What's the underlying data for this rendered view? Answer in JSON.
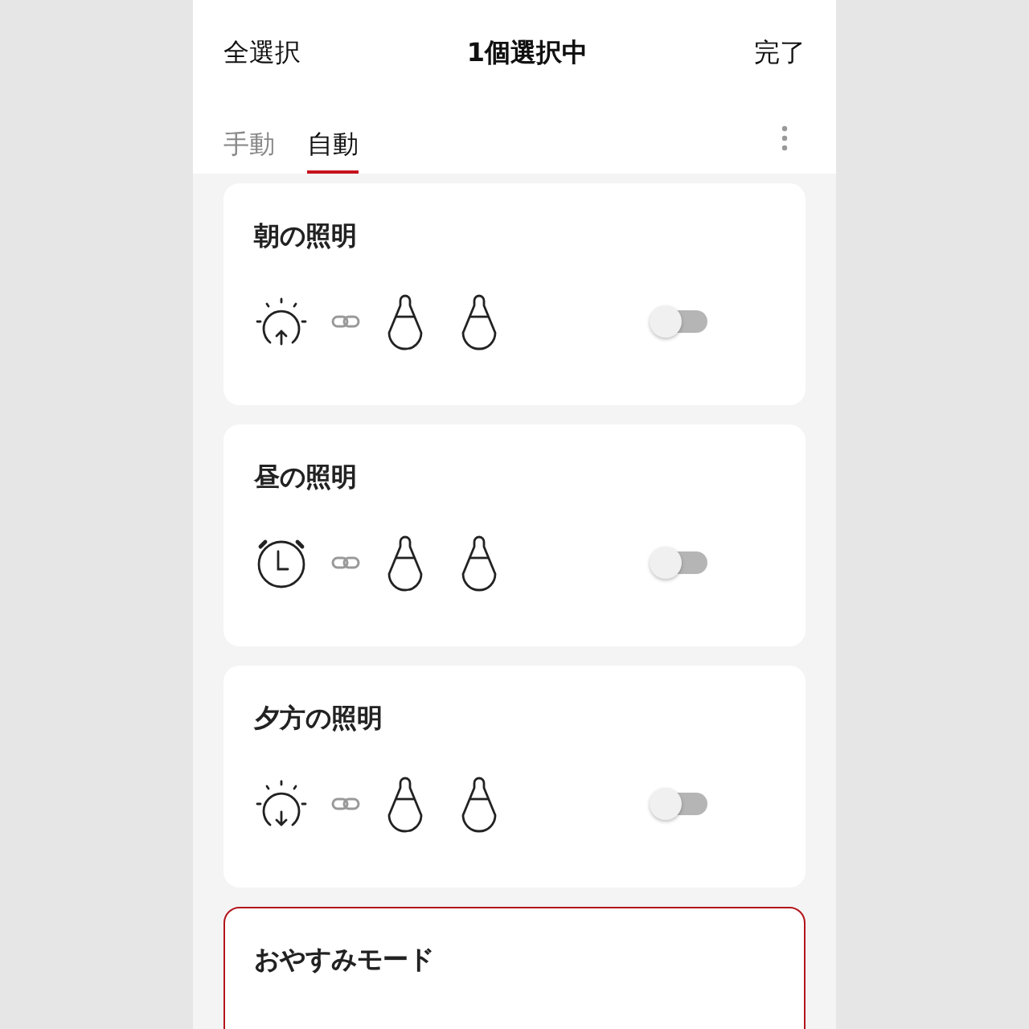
{
  "header": {
    "left_action": "全選択",
    "title": "1個選択中",
    "right_action": "完了"
  },
  "tabs": [
    {
      "label": "手動",
      "selected": false
    },
    {
      "label": "自動",
      "selected": true
    }
  ],
  "scenes": [
    {
      "name": "朝の照明",
      "selected": false,
      "trigger": {
        "kind": "sunrise"
      },
      "devices": [
        {
          "kind": "bulb"
        },
        {
          "kind": "bulb"
        }
      ],
      "on": false
    },
    {
      "name": "昼の照明",
      "selected": false,
      "trigger": {
        "kind": "alarm"
      },
      "devices": [
        {
          "kind": "bulb"
        },
        {
          "kind": "bulb"
        }
      ],
      "on": false
    },
    {
      "name": "夕方の照明",
      "selected": false,
      "trigger": {
        "kind": "sunset"
      },
      "devices": [
        {
          "kind": "bulb"
        },
        {
          "kind": "bulb"
        }
      ],
      "on": false
    },
    {
      "name": "おやすみモード",
      "selected": true
    }
  ]
}
